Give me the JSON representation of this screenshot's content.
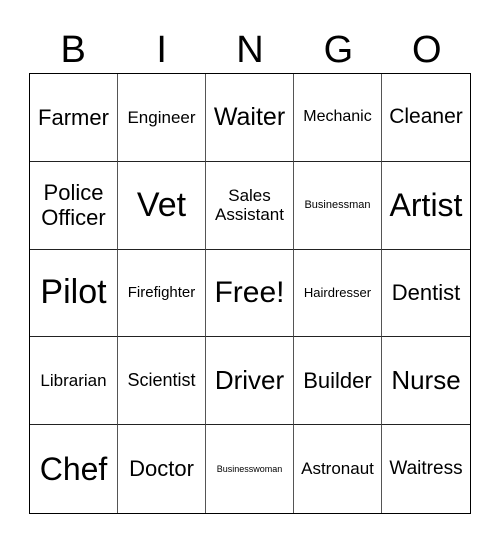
{
  "header": {
    "letters": [
      "B",
      "I",
      "N",
      "G",
      "O"
    ]
  },
  "cells": [
    {
      "text": "Farmer",
      "size": 22
    },
    {
      "text": "Engineer",
      "size": 17
    },
    {
      "text": "Waiter",
      "size": 25
    },
    {
      "text": "Mechanic",
      "size": 16
    },
    {
      "text": "Cleaner",
      "size": 21
    },
    {
      "text": "Police Officer",
      "size": 22
    },
    {
      "text": "Vet",
      "size": 34
    },
    {
      "text": "Sales Assistant",
      "size": 17
    },
    {
      "text": "Businessman",
      "size": 11
    },
    {
      "text": "Artist",
      "size": 32
    },
    {
      "text": "Pilot",
      "size": 34
    },
    {
      "text": "Firefighter",
      "size": 15
    },
    {
      "text": "Free!",
      "size": 30
    },
    {
      "text": "Hairdresser",
      "size": 13
    },
    {
      "text": "Dentist",
      "size": 22
    },
    {
      "text": "Librarian",
      "size": 17
    },
    {
      "text": "Scientist",
      "size": 18
    },
    {
      "text": "Driver",
      "size": 26
    },
    {
      "text": "Builder",
      "size": 22
    },
    {
      "text": "Nurse",
      "size": 26
    },
    {
      "text": "Chef",
      "size": 32
    },
    {
      "text": "Doctor",
      "size": 22
    },
    {
      "text": "Businesswoman",
      "size": 9
    },
    {
      "text": "Astronaut",
      "size": 17
    },
    {
      "text": "Waitress",
      "size": 19
    }
  ]
}
